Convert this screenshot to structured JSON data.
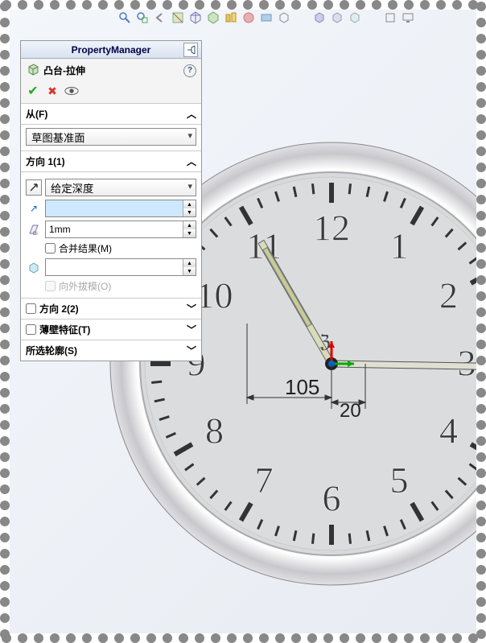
{
  "panel": {
    "title": "PropertyManager",
    "feature_name": "凸台-拉伸",
    "from": {
      "label": "从(F)",
      "value": "草图基准面"
    },
    "dir1": {
      "label": "方向 1(1)",
      "end_condition": "给定深度",
      "depth_value": "",
      "draft_value": "1mm",
      "merge_label": "合并结果(M)",
      "draft_outward_label": "向外拔模(O)"
    },
    "dir2_label": "方向 2(2)",
    "thin_label": "薄壁特征(T)",
    "contours_label": "所选轮廓(S)"
  },
  "dimensions": {
    "d1": "105",
    "d2": "20"
  },
  "clock_numbers": [
    "12",
    "1",
    "2",
    "3",
    "4",
    "5",
    "6",
    "7",
    "8",
    "9",
    "10",
    "11"
  ]
}
